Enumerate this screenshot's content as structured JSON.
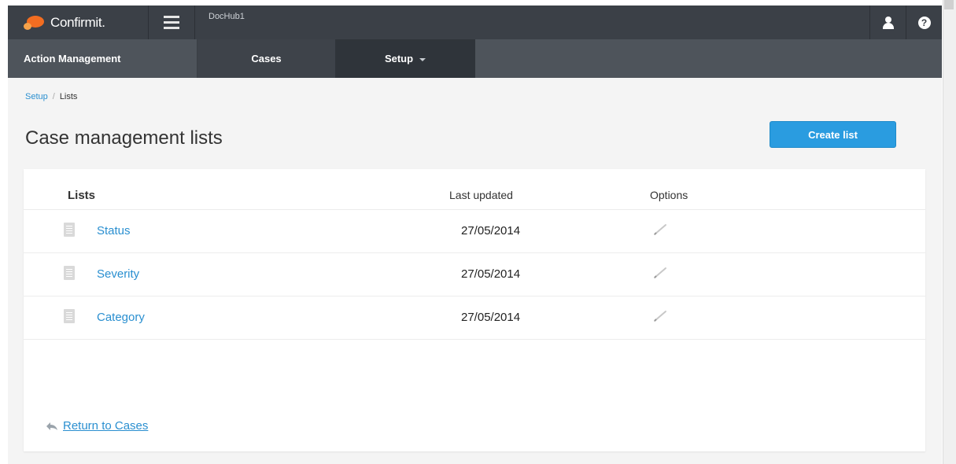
{
  "topbar": {
    "logo_text": "Confirmit.",
    "project_name": "DocHub1",
    "user_icon": "user-icon",
    "help_icon": "help-icon",
    "help_glyph": "?"
  },
  "nav": {
    "brand": "Action Management",
    "items": [
      {
        "label": "Cases"
      },
      {
        "label": "Setup"
      }
    ]
  },
  "breadcrumb": {
    "parent": "Setup",
    "current": "Lists",
    "separator": "/"
  },
  "page": {
    "title": "Case management lists",
    "create_button": "Create list"
  },
  "table": {
    "columns": [
      "Lists",
      "Last updated",
      "Options"
    ],
    "rows": [
      {
        "name": "Status",
        "updated": "27/05/2014"
      },
      {
        "name": "Severity",
        "updated": "27/05/2014"
      },
      {
        "name": "Category",
        "updated": "27/05/2014"
      }
    ]
  },
  "footer": {
    "return_link": "Return to Cases"
  },
  "colors": {
    "topbar": "#3b4047",
    "navbar": "#4e545b",
    "accent": "#2a9ce0",
    "link": "#2a8fd0",
    "logo": "#f26d21"
  }
}
